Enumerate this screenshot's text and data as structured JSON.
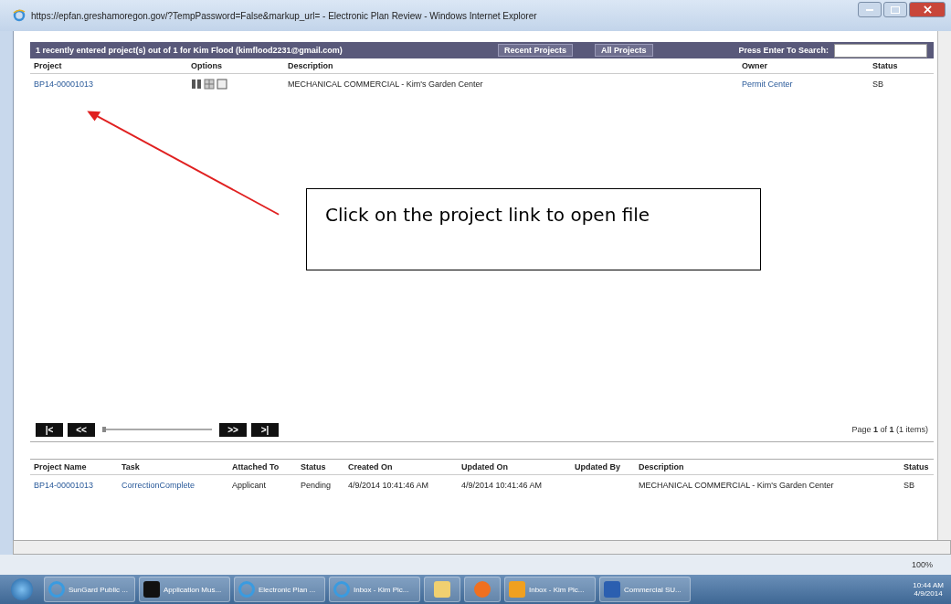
{
  "window": {
    "title": "https://epfan.greshamoregon.gov/?TempPassword=False&markup_url= - Electronic Plan Review - Windows Internet Explorer"
  },
  "header": {
    "summary": "1 recently entered project(s) out of 1 for Kim Flood (kimflood2231@gmail.com)",
    "buttons": [
      "Recent Projects",
      "All Projects"
    ],
    "search": {
      "label": "Press Enter To Search:"
    }
  },
  "projects": {
    "columns": [
      "Project",
      "Options",
      "Description",
      "Owner",
      "Status"
    ],
    "rows": [
      {
        "project": "BP14-00001013",
        "description": "MECHANICAL COMMERCIAL - Kim's Garden Center",
        "owner": "Permit Center",
        "status": "SB"
      }
    ]
  },
  "callout": {
    "text": "Click on the project link to open file"
  },
  "pager": {
    "buttons": [
      "|<",
      "<<",
      ">>",
      ">|"
    ],
    "info": "Page **1** of **1** (1 items)",
    "level": 0
  },
  "tasks": {
    "columns": [
      "Project Name",
      "Task",
      "Attached To",
      "Status",
      "Created On",
      "Updated On",
      "Updated By",
      "Description",
      "Status"
    ],
    "rows": [
      {
        "cells": [
          "BP14-00001013",
          "CorrectionComplete",
          "Applicant",
          "Pending",
          "4/9/2014 10:41:46 AM",
          "4/9/2014 10:41:46 AM",
          "",
          "MECHANICAL COMMERCIAL - Kim's Garden Center",
          "SB"
        ]
      }
    ]
  },
  "status_bar": {
    "zoom": "100%"
  },
  "taskbar": {
    "items": [
      {
        "kind": "ie",
        "label": "SunGard Public ..."
      },
      {
        "kind": "s",
        "label": "Application Mus..."
      },
      {
        "kind": "ie",
        "label": "Electronic Plan ..."
      },
      {
        "kind": "ie",
        "label": "Inbox - Kim Pic..."
      },
      {
        "kind": "folder"
      },
      {
        "kind": "media"
      },
      {
        "kind": "outlook",
        "label": "Inbox - Kim Pic..."
      },
      {
        "kind": "word",
        "label": "Commercial SU..."
      }
    ],
    "time": "10:44 AM",
    "date": "4/9/2014"
  }
}
